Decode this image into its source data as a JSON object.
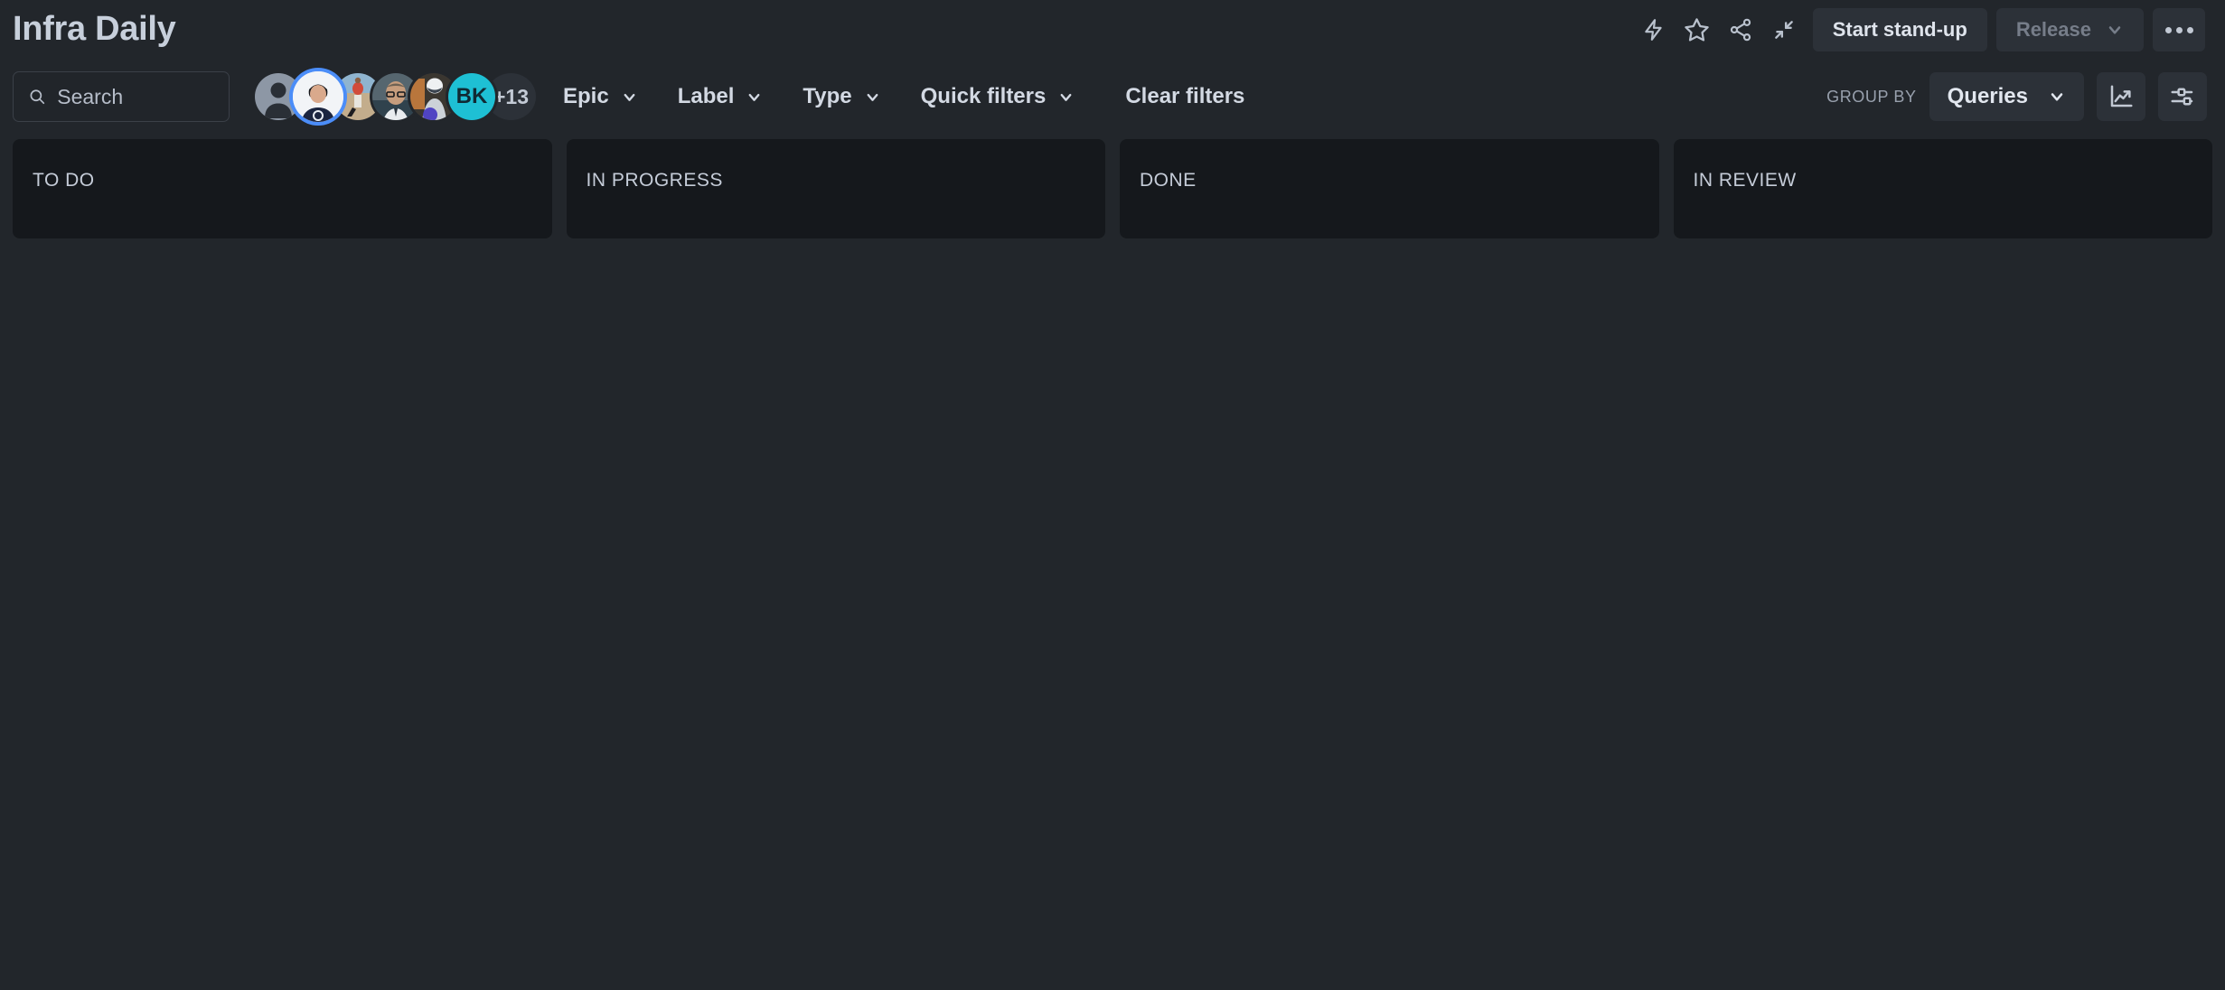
{
  "header": {
    "title": "Infra Daily",
    "actions": [
      {
        "name": "lightning-icon",
        "label": "Automation"
      },
      {
        "name": "star-icon",
        "label": "Star board"
      },
      {
        "name": "share-icon",
        "label": "Share"
      },
      {
        "name": "collapse-icon",
        "label": "Collapse"
      }
    ],
    "standup_label": "Start stand-up",
    "release_label": "Release",
    "more_label": "More actions"
  },
  "filters": {
    "search": {
      "placeholder": "Search",
      "value": ""
    },
    "avatars": [
      {
        "name": "avatar-unassigned",
        "kind": "silhouette",
        "label": "Unassigned"
      },
      {
        "name": "avatar-member-1",
        "kind": "photo",
        "selected": true,
        "label": "Member 1"
      },
      {
        "name": "avatar-member-2",
        "kind": "photo",
        "label": "Member 2"
      },
      {
        "name": "avatar-member-3",
        "kind": "photo",
        "label": "Member 3"
      },
      {
        "name": "avatar-member-4",
        "kind": "photo",
        "label": "Member 4"
      },
      {
        "name": "avatar-member-5",
        "kind": "initials",
        "initials": "BK",
        "color": "#1ec0d4",
        "label": "BK"
      }
    ],
    "avatar_overflow": "+13",
    "dropdowns": [
      {
        "name": "filter-epic",
        "label": "Epic"
      },
      {
        "name": "filter-label",
        "label": "Label"
      },
      {
        "name": "filter-type",
        "label": "Type"
      },
      {
        "name": "filter-quick-filters",
        "label": "Quick filters"
      }
    ],
    "clear_filters_label": "Clear filters",
    "group_by_label": "GROUP BY",
    "group_by_value": "Queries",
    "insights_label": "Insights",
    "settings_label": "Board settings"
  },
  "board": {
    "columns": [
      {
        "name": "column-to-do",
        "title": "TO DO",
        "cards": []
      },
      {
        "name": "column-in-progress",
        "title": "IN PROGRESS",
        "cards": []
      },
      {
        "name": "column-done",
        "title": "DONE",
        "cards": []
      },
      {
        "name": "column-in-review",
        "title": "IN REVIEW",
        "cards": []
      }
    ]
  },
  "colors": {
    "page_background": "#22262b",
    "column_background": "#15181c",
    "button_background": "#2c3138",
    "accent_selected": "#4b8df8",
    "avatar_teal": "#1ec0d4",
    "text_primary": "#d3d9e3",
    "text_muted": "#98a0ad"
  }
}
